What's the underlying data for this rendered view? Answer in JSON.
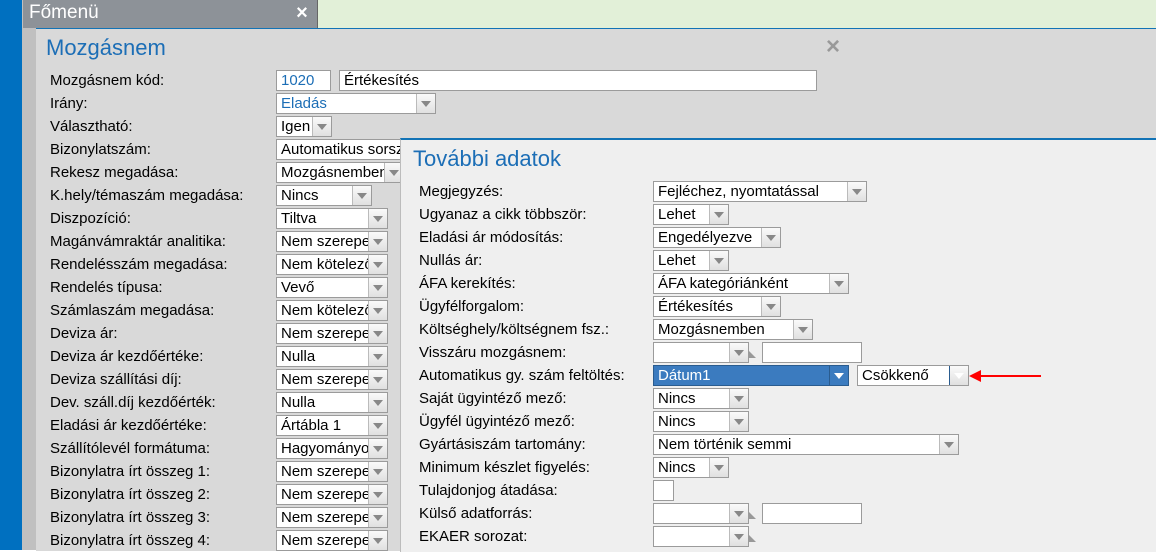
{
  "mainmenu": {
    "title": "Főmenü"
  },
  "mozgasnem": {
    "panel_title": "Mozgásnem",
    "rows": {
      "kod_label": "Mozgásnem kód:",
      "kod_value": "1020",
      "kod_name": "Értékesítés",
      "irany_label": "Irány:",
      "irany_value": "Eladás",
      "valasz_label": "Választható:",
      "valasz_value": "Igen",
      "bizszam_label": "Bizonylatszám:",
      "bizszam_value": "Automatikus sorszámozás",
      "rekesz_label": "Rekesz megadása:",
      "rekesz_value": "Mozgásnemben",
      "khely_label": "K.hely/témaszám megadása:",
      "khely_value": "Nincs",
      "diszp_label": "Diszpozíció:",
      "diszp_value": "Tiltva",
      "maganvam_label": "Magánvámraktár analitika:",
      "maganvam_value": "Nem szerepel",
      "rendszam_label": "Rendelésszám megadása:",
      "rendszam_value": "Nem kötelező",
      "rendtip_label": "Rendelés típusa:",
      "rendtip_value": "Vevő",
      "szamszam_label": "Számlaszám megadása:",
      "szamszam_value": "Nem kötelező",
      "devar_label": "Deviza ár:",
      "devar_value": "Nem szerepel",
      "devark_label": "Deviza ár kezdőértéke:",
      "devark_value": "Nulla",
      "devsz_label": "Deviza szállítási díj:",
      "devsz_value": "Nem szerepel",
      "devszk_label": "Dev. száll.díj kezdőérték:",
      "devszk_value": "Nulla",
      "eladar_label": "Eladási ár kezdőértéke:",
      "eladar_value": "Ártábla 1",
      "szlev_label": "Szállítólevél formátuma:",
      "szlev_value": "Hagyományos",
      "bo1_label": "Bizonylatra írt összeg 1:",
      "bo1_value": "Nem szerepel",
      "bo2_label": "Bizonylatra írt összeg 2:",
      "bo2_value": "Nem szerepel",
      "bo3_label": "Bizonylatra írt összeg 3:",
      "bo3_value": "Nem szerepel",
      "bo4_label": "Bizonylatra írt összeg 4:",
      "bo4_value": "Nem szerepel"
    }
  },
  "tovabbi": {
    "panel_title": "További adatok",
    "rows": {
      "megj_label": "Megjegyzés:",
      "megj_value": "Fejléchez, nyomtatással",
      "ugyanaz_label": "Ugyanaz a cikk többször:",
      "ugyanaz_value": "Lehet",
      "elad_label": "Eladási ár módosítás:",
      "elad_value": "Engedélyezve",
      "nullas_label": "Nullás ár:",
      "nullas_value": "Lehet",
      "afa_label": "ÁFA kerekítés:",
      "afa_value": "ÁFA kategóriánként",
      "ugyf_label": "Ügyfélforgalom:",
      "ugyf_value": "Értékesítés",
      "kolts_label": "Költséghely/költségnem fsz.:",
      "kolts_value": "Mozgásnemben",
      "vissz_label": "Visszáru mozgásnem:",
      "vissz_value": "",
      "vissz_extra": "",
      "auto_label": "Automatikus gy. szám feltöltés:",
      "auto_value": "Dátum1",
      "auto_order": "Csökkenő",
      "sajat_label": "Saját ügyintéző mező:",
      "sajat_value": "Nincs",
      "ugyfui_label": "Ügyfél ügyintéző mező:",
      "ugyfui_value": "Nincs",
      "gyart_label": "Gyártásiszám tartomány:",
      "gyart_value": "Nem történik semmi",
      "mink_label": "Minimum készlet figyelés:",
      "mink_value": "Nincs",
      "tulaj_label": "Tulajdonjog átadása:",
      "kulso_label": "Külső adatforrás:",
      "kulso_value": "",
      "kulso_extra": "",
      "ekaer_label": "EKAER sorozat:",
      "ekaer_value": ""
    }
  }
}
